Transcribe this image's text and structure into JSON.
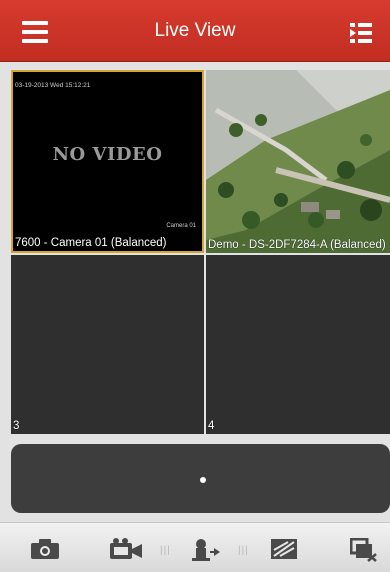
{
  "header": {
    "title": "Live View"
  },
  "grid": {
    "cells": [
      {
        "label": "7600 - Camera 01 (Balanced)",
        "status": "NO VIDEO",
        "osd_timestamp": "03-19-2013 Wed 15:12:21",
        "osd_camera": "Camera 01"
      },
      {
        "label": "Demo - DS-2DF7284-A (Balanced)"
      },
      {
        "label": "3"
      },
      {
        "label": "4"
      }
    ]
  },
  "toolbar": {
    "icons": [
      "camera-icon",
      "record-icon",
      "ptz-icon",
      "image-quality-icon",
      "close-all-icon"
    ]
  },
  "colors": {
    "header": "#d0362a",
    "selected_border": "#d4a531",
    "cell_bg": "#2f2f2f"
  }
}
